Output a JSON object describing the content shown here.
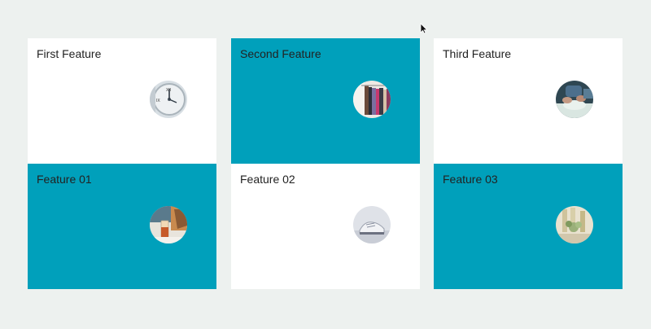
{
  "features": [
    {
      "title": "First Feature",
      "image": "clock-photo"
    },
    {
      "title": "Second Feature",
      "image": "clothing-rack-photo"
    },
    {
      "title": "Third Feature",
      "image": "hands-working-photo"
    },
    {
      "title": "Feature 01",
      "image": "drink-glass-photo"
    },
    {
      "title": "Feature 02",
      "image": "sneaker-photo"
    },
    {
      "title": "Feature 03",
      "image": "plant-bottles-photo"
    }
  ],
  "colors": {
    "background": "#edf1ef",
    "card_white": "#ffffff",
    "card_teal": "#00a0bb",
    "title_text": "#222222"
  }
}
